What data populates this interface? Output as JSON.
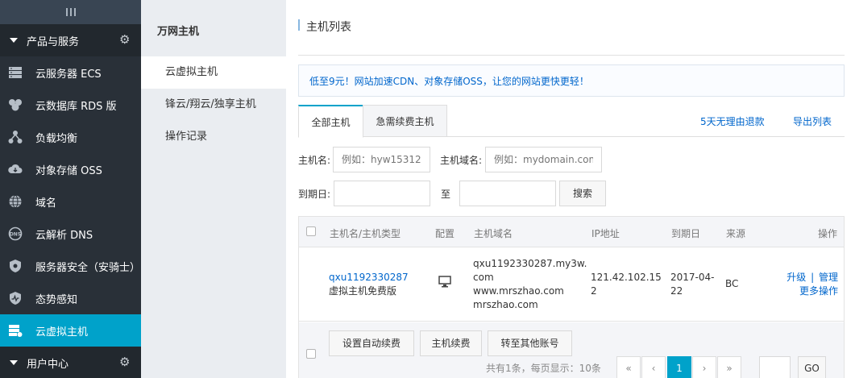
{
  "sidebar": {
    "group_label": "产品与服务",
    "items": [
      {
        "label": "云服务器 ECS",
        "icon": "server-icon"
      },
      {
        "label": "云数据库 RDS 版",
        "icon": "database-icon"
      },
      {
        "label": "负载均衡",
        "icon": "load-balancer-icon"
      },
      {
        "label": "对象存储 OSS",
        "icon": "cloud-storage-icon"
      },
      {
        "label": "域名",
        "icon": "globe-icon"
      },
      {
        "label": "云解析 DNS",
        "icon": "dns-icon"
      },
      {
        "label": "服务器安全（安骑士）",
        "icon": "shield-icon"
      },
      {
        "label": "态势感知",
        "icon": "situation-awareness-icon"
      },
      {
        "label": "云虚拟主机",
        "icon": "virtual-host-icon"
      }
    ],
    "bottom_group_label": "用户中心",
    "accent_color": "#00a2ca"
  },
  "subnav": {
    "title": "万网主机",
    "items": [
      "云虚拟主机",
      "锋云/翔云/独享主机",
      "操作记录"
    ]
  },
  "page": {
    "title": "主机列表",
    "notice": "低至9元！网站加速CDN、对象存储OSS，让您的网站更快更轻！",
    "tabs": [
      "全部主机",
      "急需续费主机"
    ],
    "refund_link": "5天无理由退款",
    "export_link": "导出列表"
  },
  "search": {
    "host_name_label": "主机名:",
    "host_name_placeholder": "例如：hyw15312",
    "domain_label": "主机域名:",
    "domain_placeholder": "例如：mydomain.com",
    "expire_label": "到期日:",
    "to_label": "至",
    "search_button": "搜索"
  },
  "table": {
    "headers": [
      "主机名/主机类型",
      "配置",
      "主机域名",
      "IP地址",
      "到期日",
      "来源",
      "操作"
    ],
    "rows": [
      {
        "host_name": "qxu1192330287",
        "host_type": "虚拟主机免费版",
        "domains": [
          "qxu1192330287.my3w.",
          "com",
          "www.mrszhao.com",
          "mrszhao.com"
        ],
        "ip_line1": "121.42.102.15",
        "ip_line2": "2",
        "expire_line1": "2017-04-",
        "expire_line2": "22",
        "source": "BC",
        "action_upgrade": "升级",
        "action_separator": "|",
        "action_manage": "管理",
        "action_more": "更多操作"
      }
    ]
  },
  "footer": {
    "btn_auto_renew": "设置自动续费",
    "btn_renew": "主机续费",
    "btn_transfer": "转至其他账号",
    "summary": "共有1条，每页显示：10条",
    "pager": [
      "«",
      "‹",
      "1",
      "›",
      "»"
    ],
    "go_button": "GO"
  }
}
